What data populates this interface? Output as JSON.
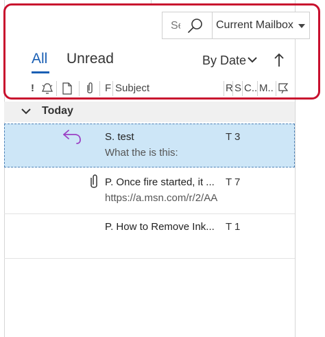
{
  "search": {
    "placeholder_visible": "Se",
    "scope": "Current Mailbox"
  },
  "tabs": {
    "all": "All",
    "unread": "Unread"
  },
  "sort": {
    "label": "By Date",
    "direction": "ascending"
  },
  "columns": {
    "importance": "!",
    "flag_col": "F",
    "subject": "Subject",
    "received": "R",
    "size": "S",
    "categories": "C..",
    "mention": "M.."
  },
  "group": {
    "label": "Today"
  },
  "messages": [
    {
      "line1": "S. test",
      "line2": "What the        is this:",
      "meta": "T 3",
      "status_icon": "reply-arrow-icon",
      "selected": true
    },
    {
      "line1": "P. Once fire started, it ...",
      "line2": "https://a.msn.com/r/2/AA",
      "meta": "T 7",
      "status_icon": "attachment-icon",
      "selected": false
    },
    {
      "line1": "P. How to Remove Ink...",
      "line2": "",
      "meta": "T 1",
      "status_icon": "",
      "selected": false
    }
  ],
  "colors": {
    "accent": "#1a5fb4",
    "highlight": "#c8102e",
    "selected_row": "#cde6f7",
    "reply_icon": "#9b3fc4"
  }
}
